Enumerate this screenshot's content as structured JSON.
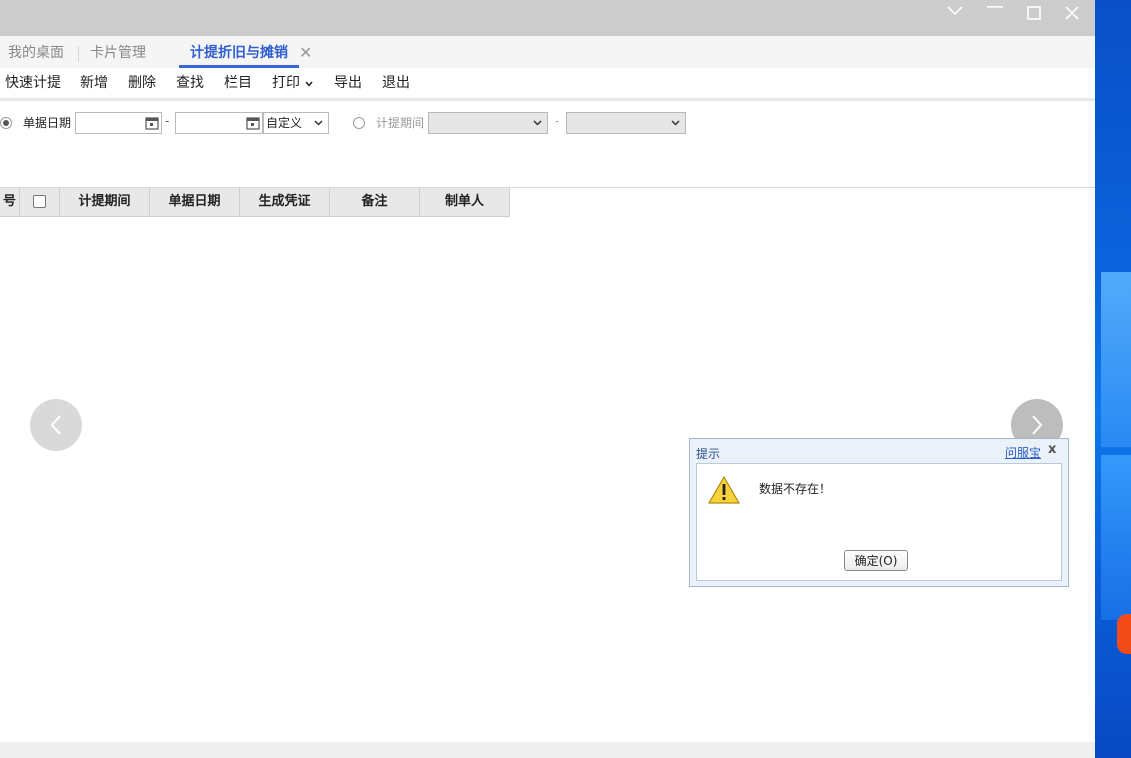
{
  "tabs": [
    {
      "label": "我的桌面"
    },
    {
      "label": "卡片管理"
    },
    {
      "label": "计提折旧与摊销"
    }
  ],
  "toolbar": {
    "quick_accrue": "快速计提",
    "add": "新增",
    "delete": "删除",
    "find": "查找",
    "columns": "栏目",
    "print": "打印",
    "export": "导出",
    "exit": "退出"
  },
  "filter": {
    "doc_date_label": "单据日期",
    "date_from": "",
    "date_to": "",
    "range_select": "自定义",
    "period_label": "计提期间",
    "period_from": "",
    "period_to": "",
    "separator": "-"
  },
  "grid": {
    "columns": [
      "号",
      "计提期间",
      "单据日期",
      "生成凭证",
      "备注",
      "制单人"
    ]
  },
  "dialog": {
    "title": "提示",
    "help_link": "问服宝",
    "close": "x",
    "message": "数据不存在！",
    "ok_label": "确定(O)"
  }
}
